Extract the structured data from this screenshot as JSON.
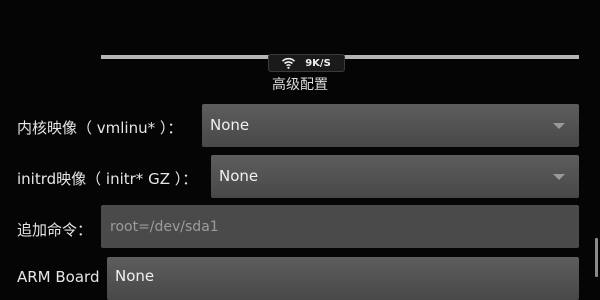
{
  "status": {
    "network_icon": "wifi-icon",
    "network_speed": "9K/S"
  },
  "section": {
    "title": "高级配置"
  },
  "fields": {
    "kernel": {
      "label": "内核映像（ vmlinu* ）：",
      "value": "None"
    },
    "initrd": {
      "label": "initrd映像（ initr* GZ ）：",
      "value": "None"
    },
    "append": {
      "label": "追加命令：",
      "value": "",
      "placeholder": "root=/dev/sda1"
    },
    "arm_board": {
      "label": "ARM Board",
      "value": "None"
    }
  },
  "colors": {
    "background": "#050505",
    "control": "#4a4a4a",
    "text": "#e6e6e6",
    "placeholder": "#9c9c9c"
  }
}
